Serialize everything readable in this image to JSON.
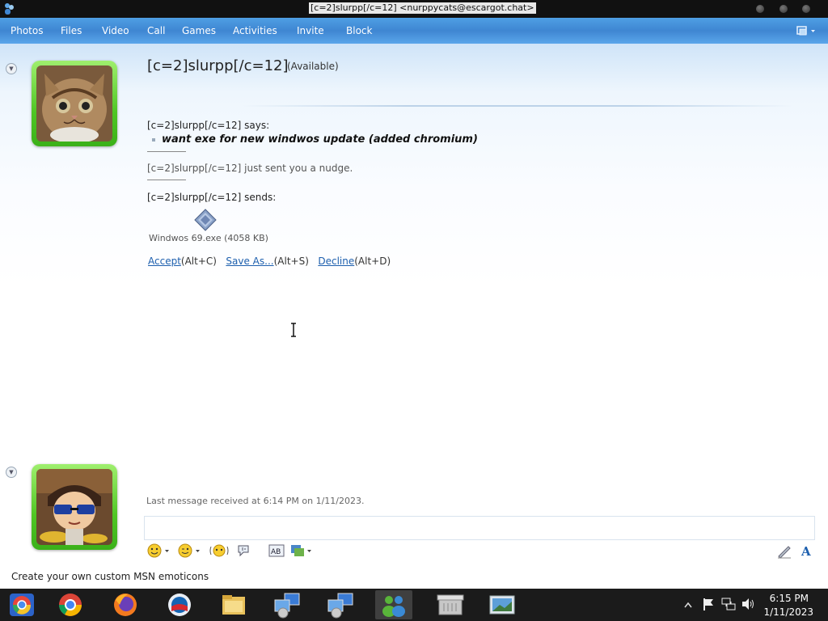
{
  "window": {
    "title": "[c=2]slurpp[/c=12] <nurppycats@escargot.chat>"
  },
  "menu": {
    "items": [
      "Photos",
      "Files",
      "Video",
      "Call",
      "Games",
      "Activities",
      "Invite",
      "Block"
    ]
  },
  "contact": {
    "name": "[c=2]slurpp[/c=12]",
    "status": "(Available)"
  },
  "conversation": {
    "says_line": "[c=2]slurpp[/c=12] says:",
    "message": "want exe for new windwos update (added chromium)",
    "nudge_line": "[c=2]slurpp[/c=12] just sent you a nudge.",
    "sends_line": "[c=2]slurpp[/c=12] sends:",
    "file_caption": "Windwos 69.exe (4058 KB)",
    "accept_label": "Accept",
    "accept_shortcut": "(Alt+C)",
    "save_label": "Save As...",
    "save_shortcut": "(Alt+S)",
    "decline_label": "Decline",
    "decline_shortcut": "(Alt+D)"
  },
  "footer": {
    "last_message": "Last message received at 6:14 PM on 1/11/2023.",
    "promo": "Create your own custom MSN emoticons"
  },
  "toolbar_icons": [
    "emoticon-icon",
    "wink-icon",
    "nudge-icon",
    "voice-clip-icon",
    "font-icon",
    "background-icon",
    "handwriting-icon",
    "text-format-icon"
  ],
  "taskbar": {
    "apps": [
      "chromium",
      "chrome",
      "firefox",
      "opera",
      "file-explorer",
      "messenger-connect",
      "messenger-connect-2",
      "msn-messenger",
      "archive",
      "picture-viewer"
    ],
    "time": "6:15 PM",
    "date": "1/11/2023"
  },
  "colors": {
    "menubar": "#3f86d2",
    "avatar_frame": "#4fc624",
    "link": "#1d5fae",
    "taskbar": "#1b1b1b"
  }
}
